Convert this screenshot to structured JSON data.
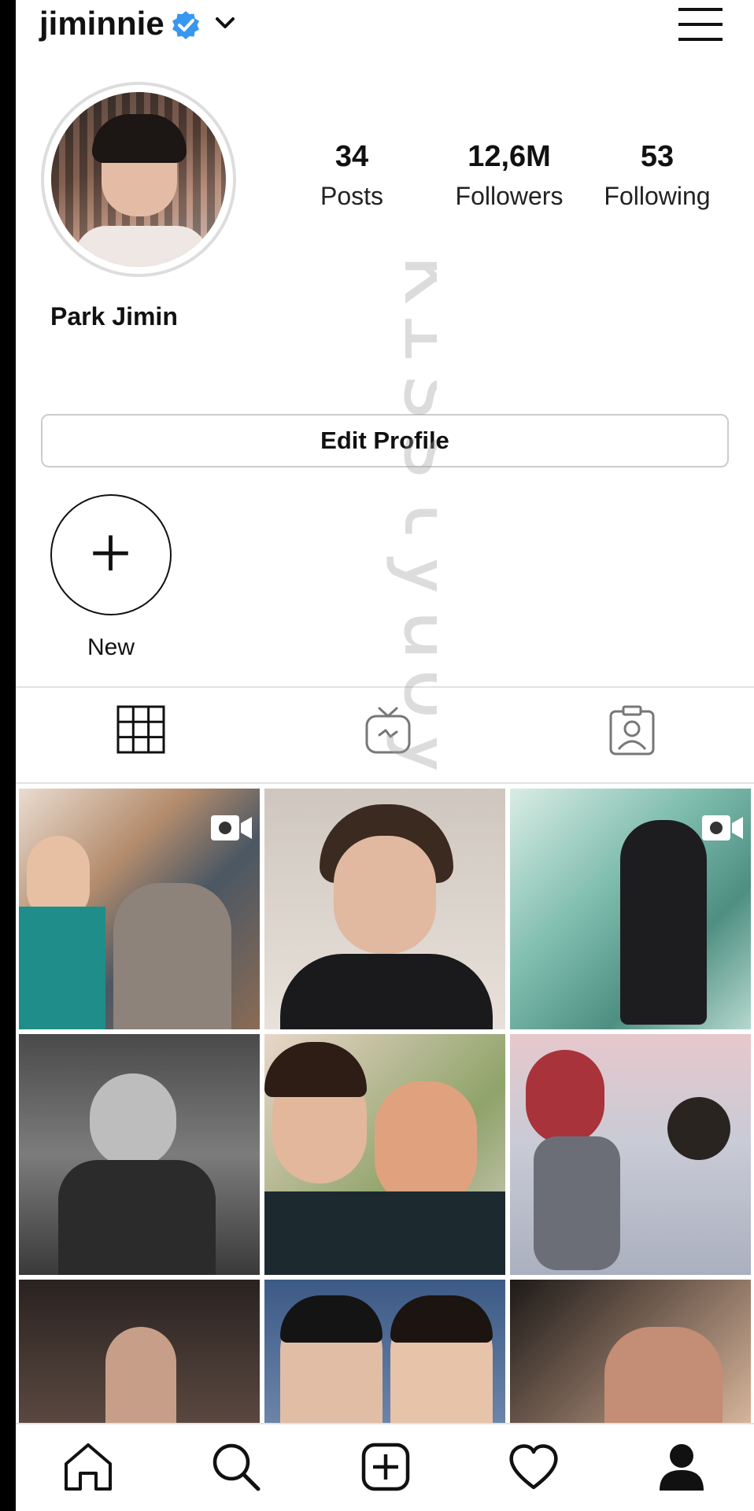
{
  "header": {
    "username": "jiminnie",
    "verified_icon": "verified-badge-icon",
    "menu_icon": "hamburger-menu-icon",
    "accent_color": "#3897f0"
  },
  "profile": {
    "display_name": "Park Jimin",
    "stats": [
      {
        "value": "34",
        "label": "Posts"
      },
      {
        "value": "12,6M",
        "label": "Followers"
      },
      {
        "value": "53",
        "label": "Following"
      }
    ],
    "edit_button": "Edit Profile"
  },
  "highlights": {
    "new_label": "New"
  },
  "tabs": [
    {
      "icon": "grid-icon",
      "active": true
    },
    {
      "icon": "igtv-icon",
      "active": false
    },
    {
      "icon": "tagged-icon",
      "active": false
    }
  ],
  "posts": [
    {
      "icon": "video-icon"
    },
    {
      "icon": "none"
    },
    {
      "icon": "video-icon"
    },
    {
      "icon": "none"
    },
    {
      "icon": "none"
    },
    {
      "icon": "none"
    },
    {
      "icon": "none"
    },
    {
      "icon": "none"
    },
    {
      "icon": "none"
    }
  ],
  "bottom_nav": [
    {
      "icon": "home-icon"
    },
    {
      "icon": "search-icon"
    },
    {
      "icon": "add-post-icon"
    },
    {
      "icon": "heart-icon"
    },
    {
      "icon": "profile-icon"
    }
  ],
  "watermark": "kisslyuoy"
}
